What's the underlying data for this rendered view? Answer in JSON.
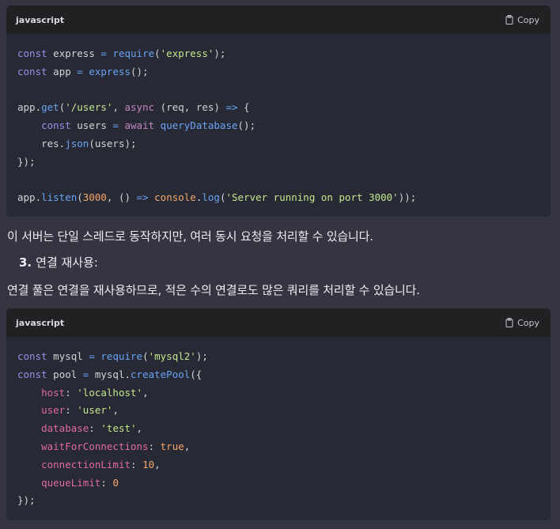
{
  "code_blocks": [
    {
      "language": "javascript",
      "copy_label": "Copy",
      "lines": [
        [
          [
            "kw2",
            "const"
          ],
          [
            "plain",
            " express "
          ],
          [
            "op",
            "="
          ],
          [
            "plain",
            " "
          ],
          [
            "fn",
            "require"
          ],
          [
            "plain",
            "("
          ],
          [
            "str",
            "'express'"
          ],
          [
            "plain",
            ");"
          ]
        ],
        [
          [
            "kw2",
            "const"
          ],
          [
            "plain",
            " app "
          ],
          [
            "op",
            "="
          ],
          [
            "plain",
            " "
          ],
          [
            "fn",
            "express"
          ],
          [
            "plain",
            "();"
          ]
        ],
        [],
        [
          [
            "plain",
            "app."
          ],
          [
            "fn",
            "get"
          ],
          [
            "plain",
            "("
          ],
          [
            "str",
            "'/users'"
          ],
          [
            "plain",
            ", "
          ],
          [
            "kw",
            "async"
          ],
          [
            "plain",
            " (req, res) "
          ],
          [
            "op",
            "=>"
          ],
          [
            "plain",
            " {"
          ]
        ],
        [
          [
            "plain",
            "    "
          ],
          [
            "kw2",
            "const"
          ],
          [
            "plain",
            " users "
          ],
          [
            "op",
            "="
          ],
          [
            "plain",
            " "
          ],
          [
            "kw",
            "await"
          ],
          [
            "plain",
            " "
          ],
          [
            "fn",
            "queryDatabase"
          ],
          [
            "plain",
            "();"
          ]
        ],
        [
          [
            "plain",
            "    res."
          ],
          [
            "fn",
            "json"
          ],
          [
            "plain",
            "(users);"
          ]
        ],
        [
          [
            "plain",
            "});"
          ]
        ],
        [],
        [
          [
            "plain",
            "app."
          ],
          [
            "fn",
            "listen"
          ],
          [
            "plain",
            "("
          ],
          [
            "num",
            "3000"
          ],
          [
            "plain",
            ", () "
          ],
          [
            "op",
            "=>"
          ],
          [
            "plain",
            " "
          ],
          [
            "num",
            "console"
          ],
          [
            "plain",
            "."
          ],
          [
            "fn",
            "log"
          ],
          [
            "plain",
            "("
          ],
          [
            "str",
            "'Server running on port 3000'"
          ],
          [
            "plain",
            "));"
          ]
        ]
      ]
    },
    {
      "language": "javascript",
      "copy_label": "Copy",
      "lines": [
        [
          [
            "kw2",
            "const"
          ],
          [
            "plain",
            " mysql "
          ],
          [
            "op",
            "="
          ],
          [
            "plain",
            " "
          ],
          [
            "fn",
            "require"
          ],
          [
            "plain",
            "("
          ],
          [
            "str",
            "'mysql2'"
          ],
          [
            "plain",
            ");"
          ]
        ],
        [
          [
            "kw2",
            "const"
          ],
          [
            "plain",
            " pool "
          ],
          [
            "op",
            "="
          ],
          [
            "plain",
            " mysql."
          ],
          [
            "fn",
            "createPool"
          ],
          [
            "plain",
            "({"
          ]
        ],
        [
          [
            "plain",
            "    "
          ],
          [
            "prop",
            "host"
          ],
          [
            "plain",
            ": "
          ],
          [
            "str",
            "'localhost'"
          ],
          [
            "plain",
            ","
          ]
        ],
        [
          [
            "plain",
            "    "
          ],
          [
            "prop",
            "user"
          ],
          [
            "plain",
            ": "
          ],
          [
            "str",
            "'user'"
          ],
          [
            "plain",
            ","
          ]
        ],
        [
          [
            "plain",
            "    "
          ],
          [
            "prop",
            "database"
          ],
          [
            "plain",
            ": "
          ],
          [
            "str",
            "'test'"
          ],
          [
            "plain",
            ","
          ]
        ],
        [
          [
            "plain",
            "    "
          ],
          [
            "prop",
            "waitForConnections"
          ],
          [
            "plain",
            ": "
          ],
          [
            "num",
            "true"
          ],
          [
            "plain",
            ","
          ]
        ],
        [
          [
            "plain",
            "    "
          ],
          [
            "prop",
            "connectionLimit"
          ],
          [
            "plain",
            ": "
          ],
          [
            "num",
            "10"
          ],
          [
            "plain",
            ","
          ]
        ],
        [
          [
            "plain",
            "    "
          ],
          [
            "prop",
            "queueLimit"
          ],
          [
            "plain",
            ": "
          ],
          [
            "num",
            "0"
          ]
        ],
        [
          [
            "plain",
            "});"
          ]
        ]
      ]
    }
  ],
  "paragraph1": "이 서버는 단일 스레드로 동작하지만, 여러 동시 요청을 처리할 수 있습니다.",
  "list_item": {
    "number": "3.",
    "text": "연결 재사용:"
  },
  "paragraph2": "연결 풀은 연결을 재사용하므로, 적은 수의 연결로도 많은 쿼리를 처리할 수 있습니다.",
  "colors": {
    "background": "#343541",
    "code_bg": "#272934",
    "header_bg": "#202123",
    "keyword": "#9b8fe8",
    "function": "#6aa3f5",
    "string": "#c3e88d",
    "number": "#f5a76a",
    "property": "#e06c9f"
  }
}
